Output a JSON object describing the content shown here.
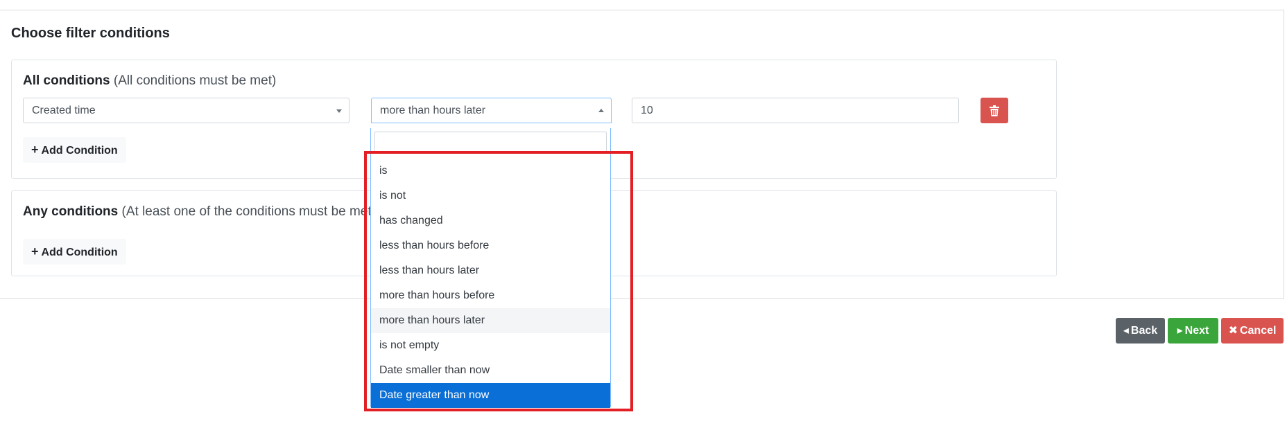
{
  "page_title": "Choose filter conditions",
  "all_conditions": {
    "title": "All conditions",
    "hint": "(All conditions must be met)",
    "row": {
      "field": "Created time",
      "operator": "more than hours later",
      "value": "10"
    },
    "add_label": "Add Condition"
  },
  "any_conditions": {
    "title": "Any conditions",
    "hint": "(At least one of the conditions must be met)",
    "add_label": "Add Condition"
  },
  "operator_dropdown": {
    "search_value": "",
    "options": [
      "is",
      "is not",
      "has changed",
      "less than hours before",
      "less than hours later",
      "more than hours before",
      "more than hours later",
      "is not empty",
      "Date smaller than now",
      "Date greater than now"
    ],
    "hovered": "more than hours later",
    "highlighted": "Date greater than now"
  },
  "actions": {
    "back": "Back",
    "next": "Next",
    "cancel": "Cancel"
  },
  "icons": {
    "trash": "trash-icon",
    "plus": "plus-icon",
    "back": "caret-left-icon",
    "next": "caret-right-icon",
    "cancel": "x-icon"
  },
  "colors": {
    "danger": "#d9534f",
    "success": "#3aa53a",
    "secondary": "#5a6268",
    "selected_option": "#0a6fd6",
    "annotation": "#e31e24"
  }
}
